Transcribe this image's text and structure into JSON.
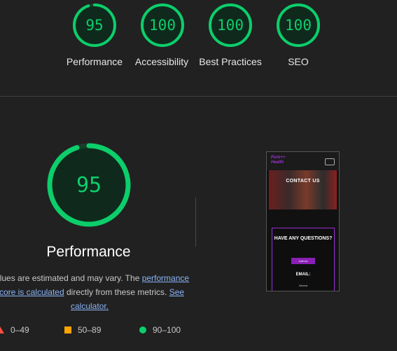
{
  "categories": [
    {
      "score": "95",
      "label": "Performance",
      "fraction": 0.95
    },
    {
      "score": "100",
      "label": "Accessibility",
      "fraction": 1.0
    },
    {
      "score": "100",
      "label": "Best Practices",
      "fraction": 1.0
    },
    {
      "score": "100",
      "label": "SEO",
      "fraction": 1.0
    }
  ],
  "main": {
    "score": "95",
    "fraction": 0.95,
    "title": "Performance",
    "note_part1": "Values are estimated and may vary. The ",
    "note_link": "performance score is calculated",
    "note_part2": " directly from these metrics. ",
    "note_link2": "See calculator."
  },
  "legend": [
    {
      "label": "0–49",
      "shape": "triangle",
      "color": "#ff4e42"
    },
    {
      "label": "50–89",
      "shape": "square",
      "color": "#ffa400"
    },
    {
      "label": "90–100",
      "shape": "circle",
      "color": "#0cce6b"
    }
  ],
  "preview": {
    "brand_line1": "Pure++",
    "brand_line2": "Health",
    "hero_text": "CONTACT US",
    "question": "HAVE ANY QUESTIONS?",
    "button": "Call Us",
    "email": "EMAIL:",
    "general": "General"
  },
  "colors": {
    "pass": "#0cce6b",
    "average": "#ffa400",
    "fail": "#ff4e42",
    "link": "#8ab4f8"
  }
}
